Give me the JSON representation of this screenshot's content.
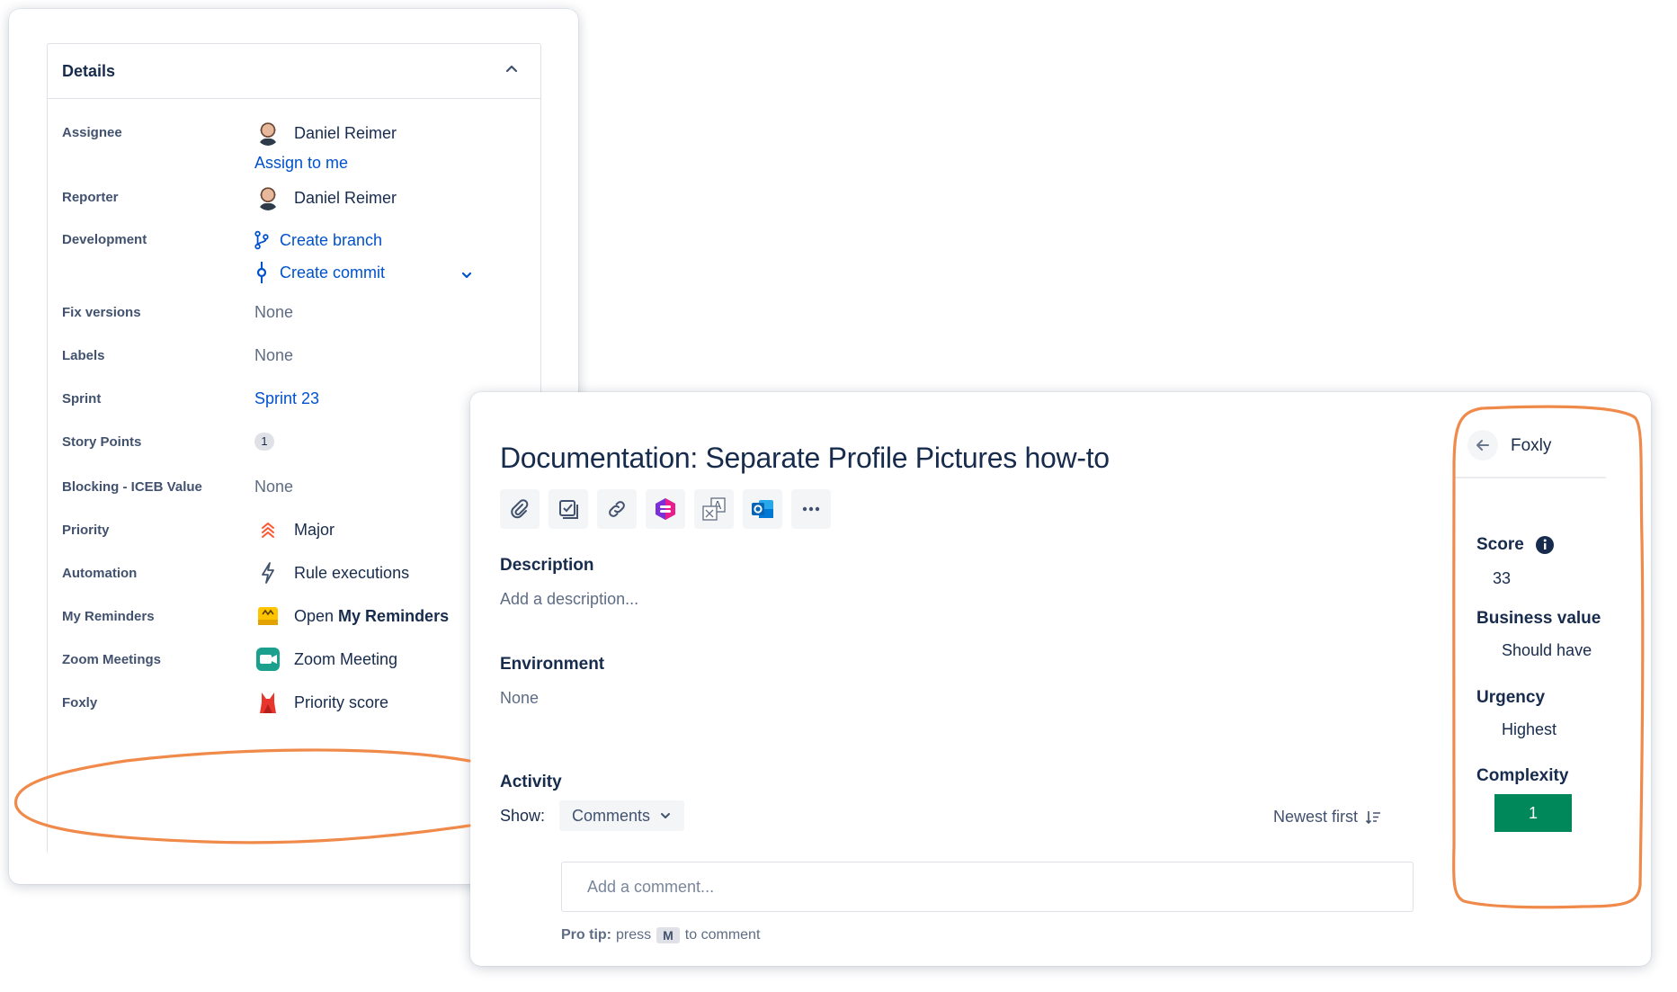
{
  "details": {
    "title": "Details",
    "fields": [
      {
        "label": "Assignee",
        "value": "Daniel Reimer",
        "action": "Assign to me"
      },
      {
        "label": "Reporter",
        "value": "Daniel Reimer"
      },
      {
        "label": "Development",
        "branch": "Create branch",
        "commit": "Create commit"
      },
      {
        "label": "Fix versions",
        "value": "None"
      },
      {
        "label": "Labels",
        "value": "None"
      },
      {
        "label": "Sprint",
        "value": "Sprint 23"
      },
      {
        "label": "Story Points",
        "value": "1"
      },
      {
        "label": "Blocking - ICEB Value",
        "value": "None"
      },
      {
        "label": "Priority",
        "value": "Major"
      },
      {
        "label": "Automation",
        "value": "Rule executions"
      },
      {
        "label": "My Reminders",
        "value_prefix": "Open ",
        "value_bold": "My Reminders"
      },
      {
        "label": "Zoom Meetings",
        "value": "Zoom Meeting"
      },
      {
        "label": "Foxly",
        "value": "Priority score"
      }
    ]
  },
  "issue": {
    "title": "Documentation: Separate Profile Pictures how-to",
    "toolbar_icons": [
      "attachment-icon",
      "checklist-icon",
      "link-icon",
      "app-stack-icon",
      "translate-icon",
      "outlook-icon",
      "more-icon"
    ],
    "description": {
      "heading": "Description",
      "placeholder": "Add a description..."
    },
    "environment": {
      "heading": "Environment",
      "value": "None"
    },
    "activity": {
      "heading": "Activity",
      "show_label": "Show:",
      "filter": "Comments",
      "sort": "Newest first",
      "comment_placeholder": "Add a comment...",
      "protip_label": "Pro tip:",
      "protip_press": "press",
      "protip_key": "M",
      "protip_suffix": "to comment"
    }
  },
  "foxly_panel": {
    "name": "Foxly",
    "score_label": "Score",
    "score": "33",
    "business_value_label": "Business value",
    "business_value": "Should have",
    "urgency_label": "Urgency",
    "urgency": "Highest",
    "complexity_label": "Complexity",
    "complexity": "1"
  },
  "colors": {
    "highlight": "#f08a4b",
    "link": "#0052cc",
    "complexity_green": "#00875a",
    "priority_major": "#ff5630"
  }
}
